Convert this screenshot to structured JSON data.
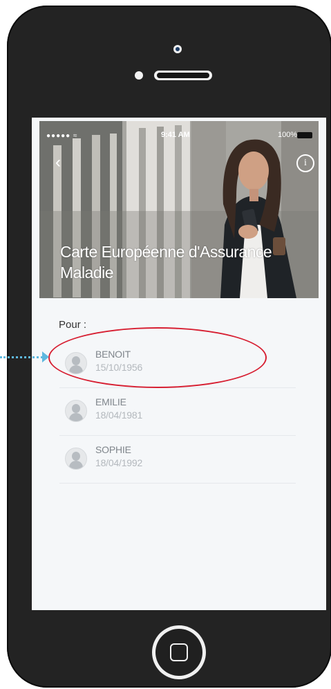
{
  "status_bar": {
    "signal": "●●●●● ≈",
    "time": "9:41 AM",
    "battery": "100%"
  },
  "header": {
    "title": "Carte Européenne d'Assurance Maladie",
    "back_icon": "back-chevron-icon",
    "info_icon": "info-icon"
  },
  "section_label": "Pour :",
  "beneficiaries": [
    {
      "name": "BENOIT",
      "date": "15/10/1956"
    },
    {
      "name": "EMILIE",
      "date": "18/04/1981"
    },
    {
      "name": "SOPHIE",
      "date": "18/04/1992"
    }
  ],
  "colors": {
    "highlight": "#d71f32",
    "arrow": "#5eb8df",
    "screen_bg": "#f5f7f9"
  }
}
